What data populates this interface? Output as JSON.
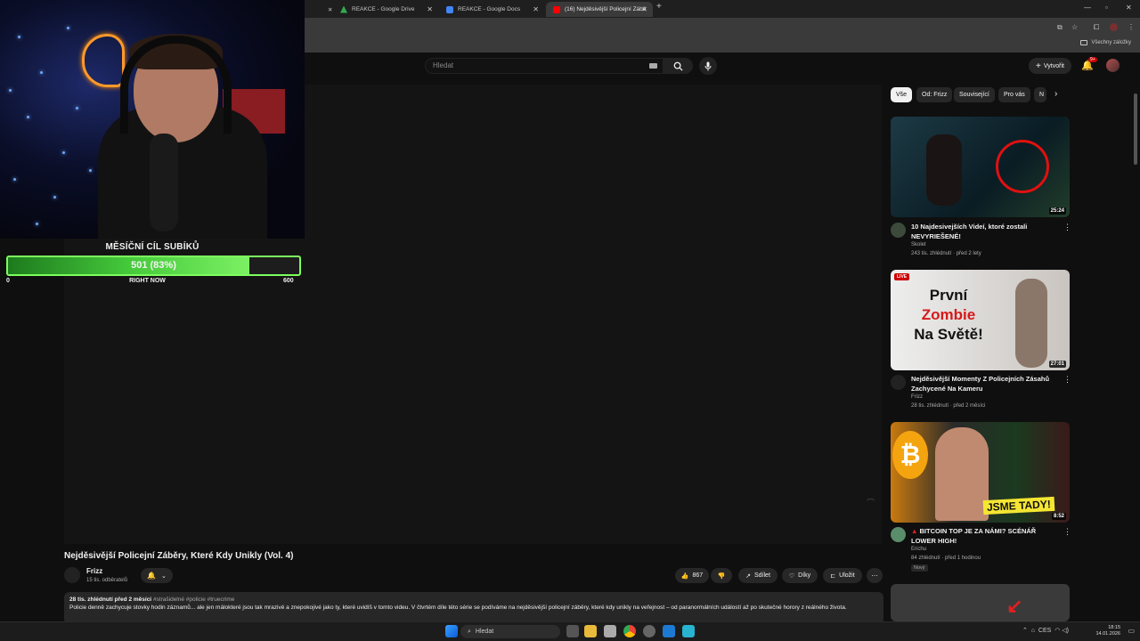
{
  "browser": {
    "tabs": [
      {
        "label": "REAKCE - Google Drive",
        "favicon_color": "#34a853"
      },
      {
        "label": "REAKCE - Google Docs",
        "favicon_color": "#4285f4"
      },
      {
        "label": "(16) Nejděsivější Policejní Zábě",
        "favicon_color": "#ff0000"
      }
    ],
    "bookmarks_label": "Všechny záložky"
  },
  "youtube": {
    "search_placeholder": "Hledat",
    "create_label": "Vytvořit",
    "notif_count": "9+"
  },
  "overlay": {
    "goal_title": "MĚSÍČNÍ CÍL SUBÍKŮ",
    "goal_text": "501 (83%)",
    "goal_progress": 0.83,
    "min_label": "0",
    "mid_label": "RIGHT NOW",
    "max_label": "600"
  },
  "video": {
    "title": "Nejděsivější Policejní Záběry, Které Kdy Unikly (Vol. 4)",
    "channel": "Frizz",
    "subscribers": "15 tis. odběratelů",
    "likes": "867",
    "share_label": "Sdílet",
    "thanks_label": "Díky",
    "save_label": "Uložit",
    "desc_stats": "28 tis. zhlédnutí  před 2 měsíci",
    "desc_tags": "#strašidelné #policie #truecrime",
    "desc_text": "Policie denně zachycuje stovky hodin záznamů... ale jen málokteré jsou tak mrazivé a znepokojivé jako ty, které uvidíš v tomto videu. V čtvrtém díle této série se podíváme na nejděsivější policejní záběry, které kdy unikly na veřejnost – od paranormálních událostí až po skutečné horory z reálného života."
  },
  "chips": [
    "Vše",
    "Od: Frizz",
    "Související",
    "Pro vás",
    "N"
  ],
  "recommendations": [
    {
      "title": "10 Najdesivejších Videí, ktoré zostali NEVYRIEŠENÉ!",
      "channel": "Skolet",
      "meta": "243 tis. zhlédnutí · před 2 lety",
      "duration": "25:24"
    },
    {
      "title": "Nejděsivější Momenty Z Policejních Zásahů Zachycené Na Kameru",
      "channel": "Frizz",
      "meta": "28 tis. zhlédnutí · před 2 měsíci",
      "duration": "27:01",
      "live": "LIVE",
      "thumb_text": [
        "První",
        "Zombie",
        "Na Světě!"
      ]
    },
    {
      "title": "BITCOIN TOP JE ZA NÁMI? SCÉNÁŘ LOWER HIGH!",
      "channel": "Erichu",
      "meta": "84 zhlédnutí · před 1 hodinou",
      "duration": "8:52",
      "badge": "Nový",
      "thumb_text": "JSME TADY!"
    }
  ],
  "taskbar": {
    "search_label": "Hledat",
    "lang": "CES",
    "time": "18:15",
    "date": "14.01.2026"
  }
}
